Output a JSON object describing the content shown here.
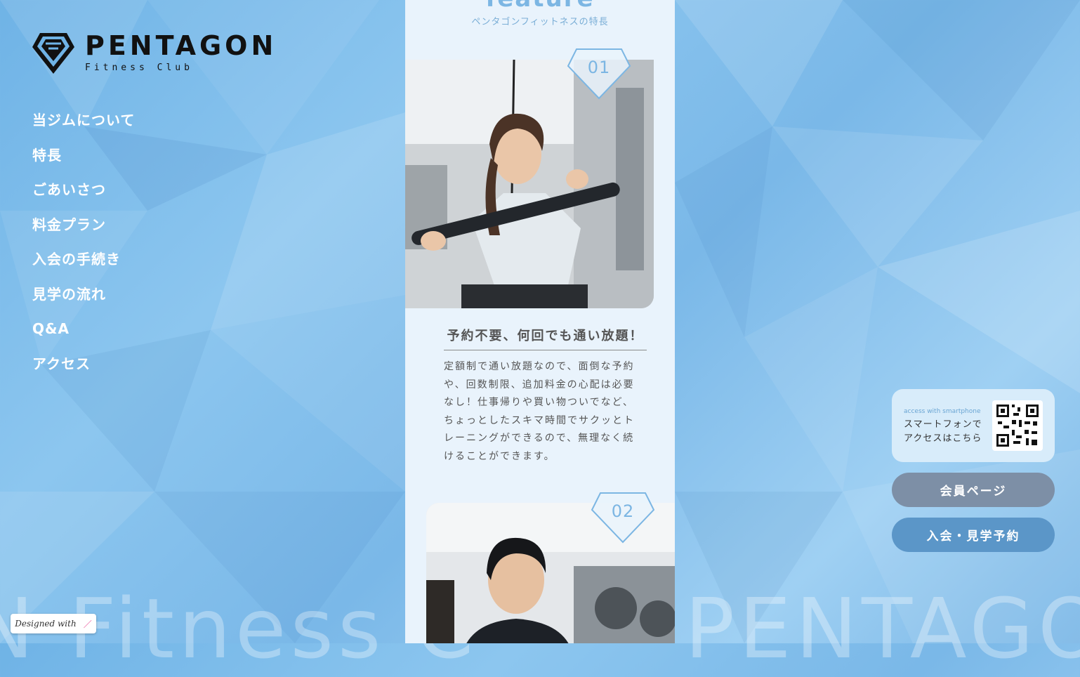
{
  "logo": {
    "name": "PENTAGON",
    "sub": "Fitness Club"
  },
  "nav": {
    "items": [
      "当ジムについて",
      "特長",
      "ごあいさつ",
      "料金プラン",
      "入会の手続き",
      "見学の流れ",
      "Q&A",
      "アクセス"
    ]
  },
  "feature": {
    "title": "feature",
    "subtitle": "ペンタゴンフィットネスの特長",
    "items": [
      {
        "num": "01",
        "heading": "予約不要、何回でも通い放題！",
        "body": "定額制で通い放題なので、面倒な予約や、回数制限、追加料金の心配は必要なし！仕事帰りや買い物ついでなど、ちょっとしたスキマ時間でサクッとトレーニングができるので、無理なく続けることができます。"
      },
      {
        "num": "02"
      }
    ]
  },
  "qr": {
    "small": "access with smartphone",
    "line1": "スマートフォンで",
    "line2": "アクセスはこちら"
  },
  "buttons": {
    "member": "会員ページ",
    "join": "入会・見学予約"
  },
  "background_text": {
    "left": "N Fitness C",
    "right": "PENTAGON"
  },
  "badge": {
    "designed": "Designed with"
  },
  "colors": {
    "accent": "#7cb6e3",
    "member_button": "#7d8fa6",
    "join_button": "#5b96c8"
  }
}
